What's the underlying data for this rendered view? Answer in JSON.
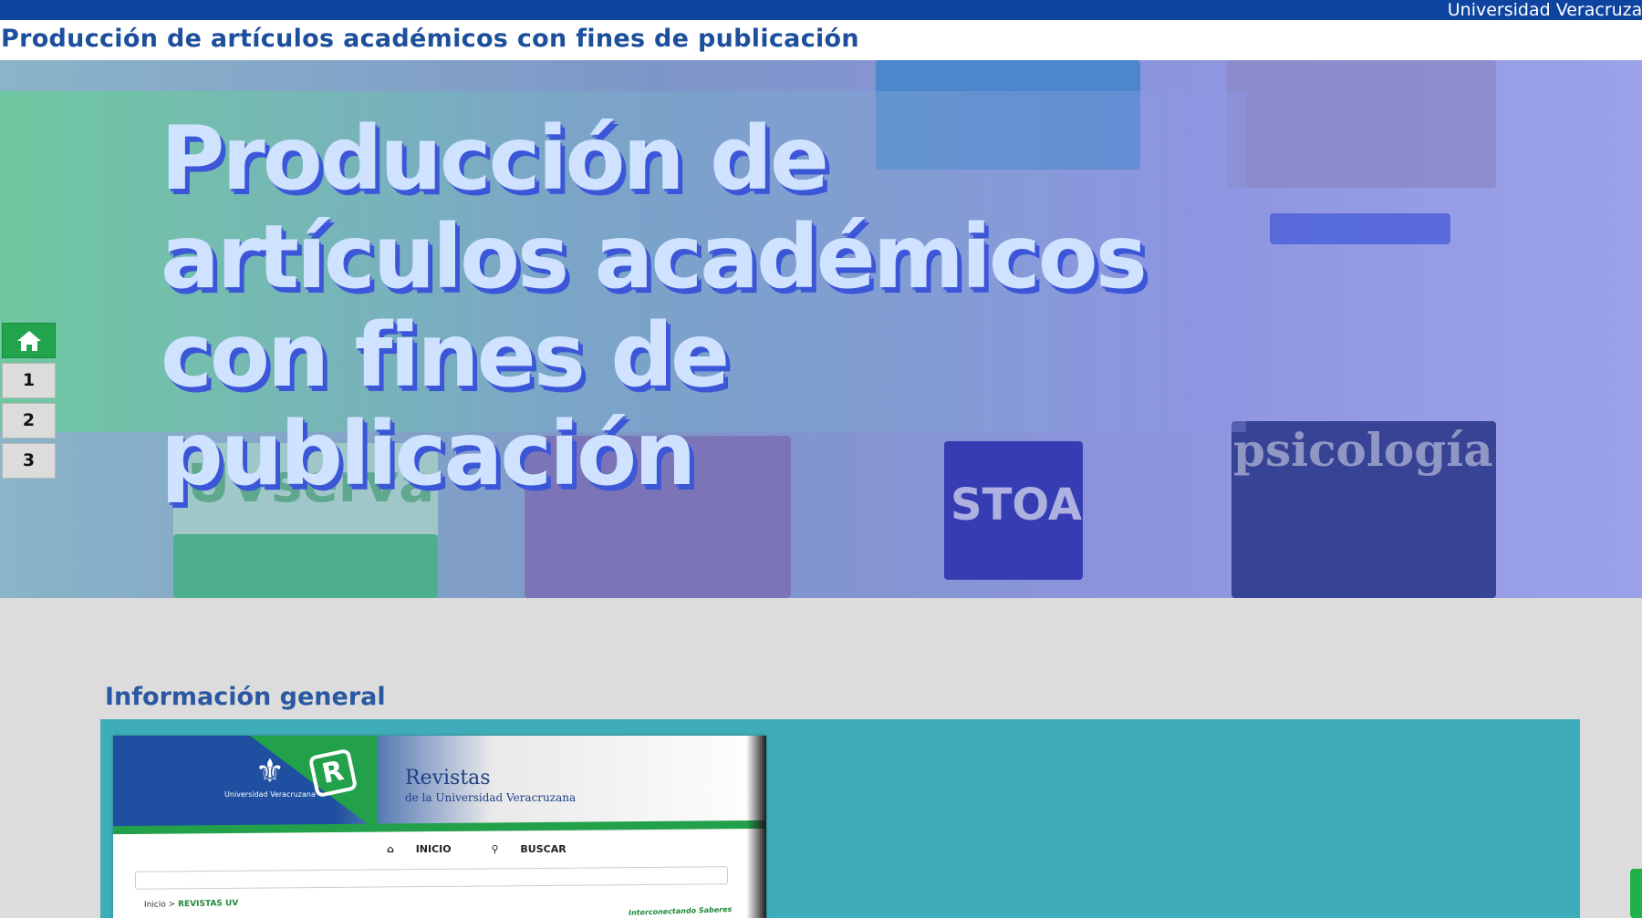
{
  "topbar": {
    "institution": "Universidad Veracruzana"
  },
  "page": {
    "title": "Producción de artículos académicos con fines de publicación"
  },
  "hero": {
    "headline": "Producción de artículos académicos con fines de publicación",
    "thumbnails": [
      "UVserva",
      "STOA",
      "psicología"
    ]
  },
  "slide_nav": {
    "home_icon": "home-icon",
    "slides": [
      "1",
      "2",
      "3"
    ]
  },
  "section": {
    "title": "Información general"
  },
  "screenshot": {
    "brand_title": "Revistas",
    "brand_subtitle": "de la Universidad Veracruzana",
    "uv_caption": "Universidad Veracruzana",
    "menu_home": "INICIO",
    "menu_search": "BUSCAR",
    "crumb_start": "Inicio >",
    "crumb_current": "REVISTAS UV",
    "tagline": "Interconectando Saberes"
  },
  "colors": {
    "topbar": "#0e44a0",
    "title": "#1c4f9c",
    "accent_green": "#21a44b",
    "panel": "#3eadb9",
    "page_bg": "#dcdcdc"
  }
}
